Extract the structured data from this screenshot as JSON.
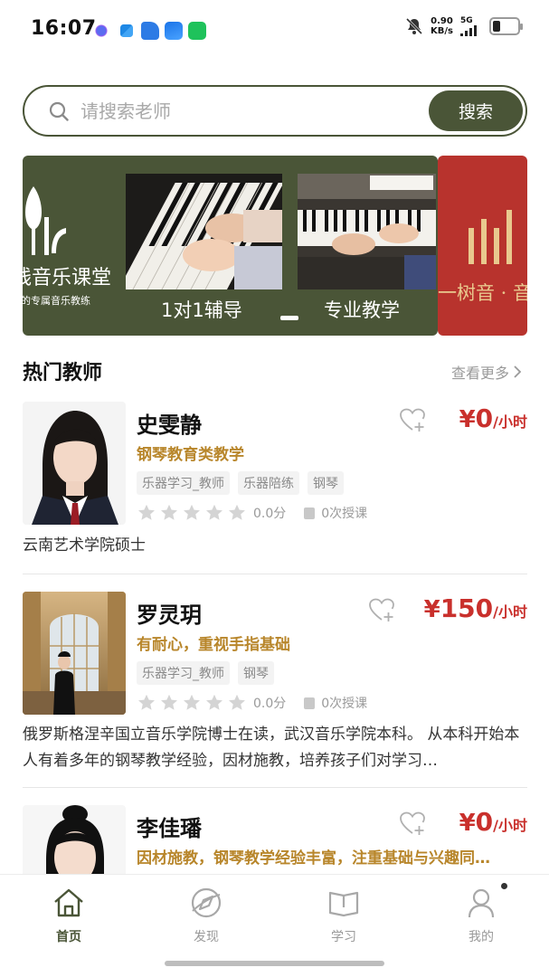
{
  "status_bar": {
    "time": "16:07",
    "net_speed_value": "0.90",
    "net_speed_unit": "KB/s",
    "network": "5G"
  },
  "search": {
    "placeholder": "请搜索老师",
    "button_label": "搜索"
  },
  "banner": {
    "brand": "线音乐课堂",
    "subtitle": "的专属音乐教练",
    "captions": [
      "1对1辅导",
      "专业教学"
    ],
    "next_text": "一树音 · 音"
  },
  "section": {
    "title": "热门教师",
    "see_more": "查看更多"
  },
  "teachers": [
    {
      "name": "史雯静",
      "slogan": "钢琴教育类教学",
      "tags": [
        "乐器学习_教师",
        "乐器陪练",
        "钢琴"
      ],
      "score": "0.0分",
      "lessons": "0次授课",
      "price_currency": "¥",
      "price": "0",
      "price_unit": "/小时",
      "rating": 0,
      "desc": "云南艺术学院硕士"
    },
    {
      "name": "罗灵玥",
      "slogan": "有耐心，重视手指基础",
      "tags": [
        "乐器学习_教师",
        "钢琴"
      ],
      "score": "0.0分",
      "lessons": "0次授课",
      "price_currency": "¥",
      "price": "150",
      "price_unit": "/小时",
      "rating": 0,
      "desc": "俄罗斯格涅辛国立音乐学院博士在读，武汉音乐学院本科。 从本科开始本人有着多年的钢琴教学经验，因材施教，培养孩子们对学习…"
    },
    {
      "name": "李佳璠",
      "slogan": "因材施教，钢琴教学经验丰富，注重基础与兴趣同…",
      "price_currency": "¥",
      "price": "0",
      "price_unit": "/小时"
    }
  ],
  "bottom_nav": [
    {
      "label": "首页",
      "icon": "home-icon",
      "active": true
    },
    {
      "label": "发现",
      "icon": "discover-icon",
      "active": false
    },
    {
      "label": "学习",
      "icon": "book-icon",
      "active": false
    },
    {
      "label": "我的",
      "icon": "profile-icon",
      "active": false
    }
  ],
  "colors": {
    "brand_green": "#4a5537",
    "price_red": "#c9302c",
    "slogan_gold": "#b8862b"
  }
}
